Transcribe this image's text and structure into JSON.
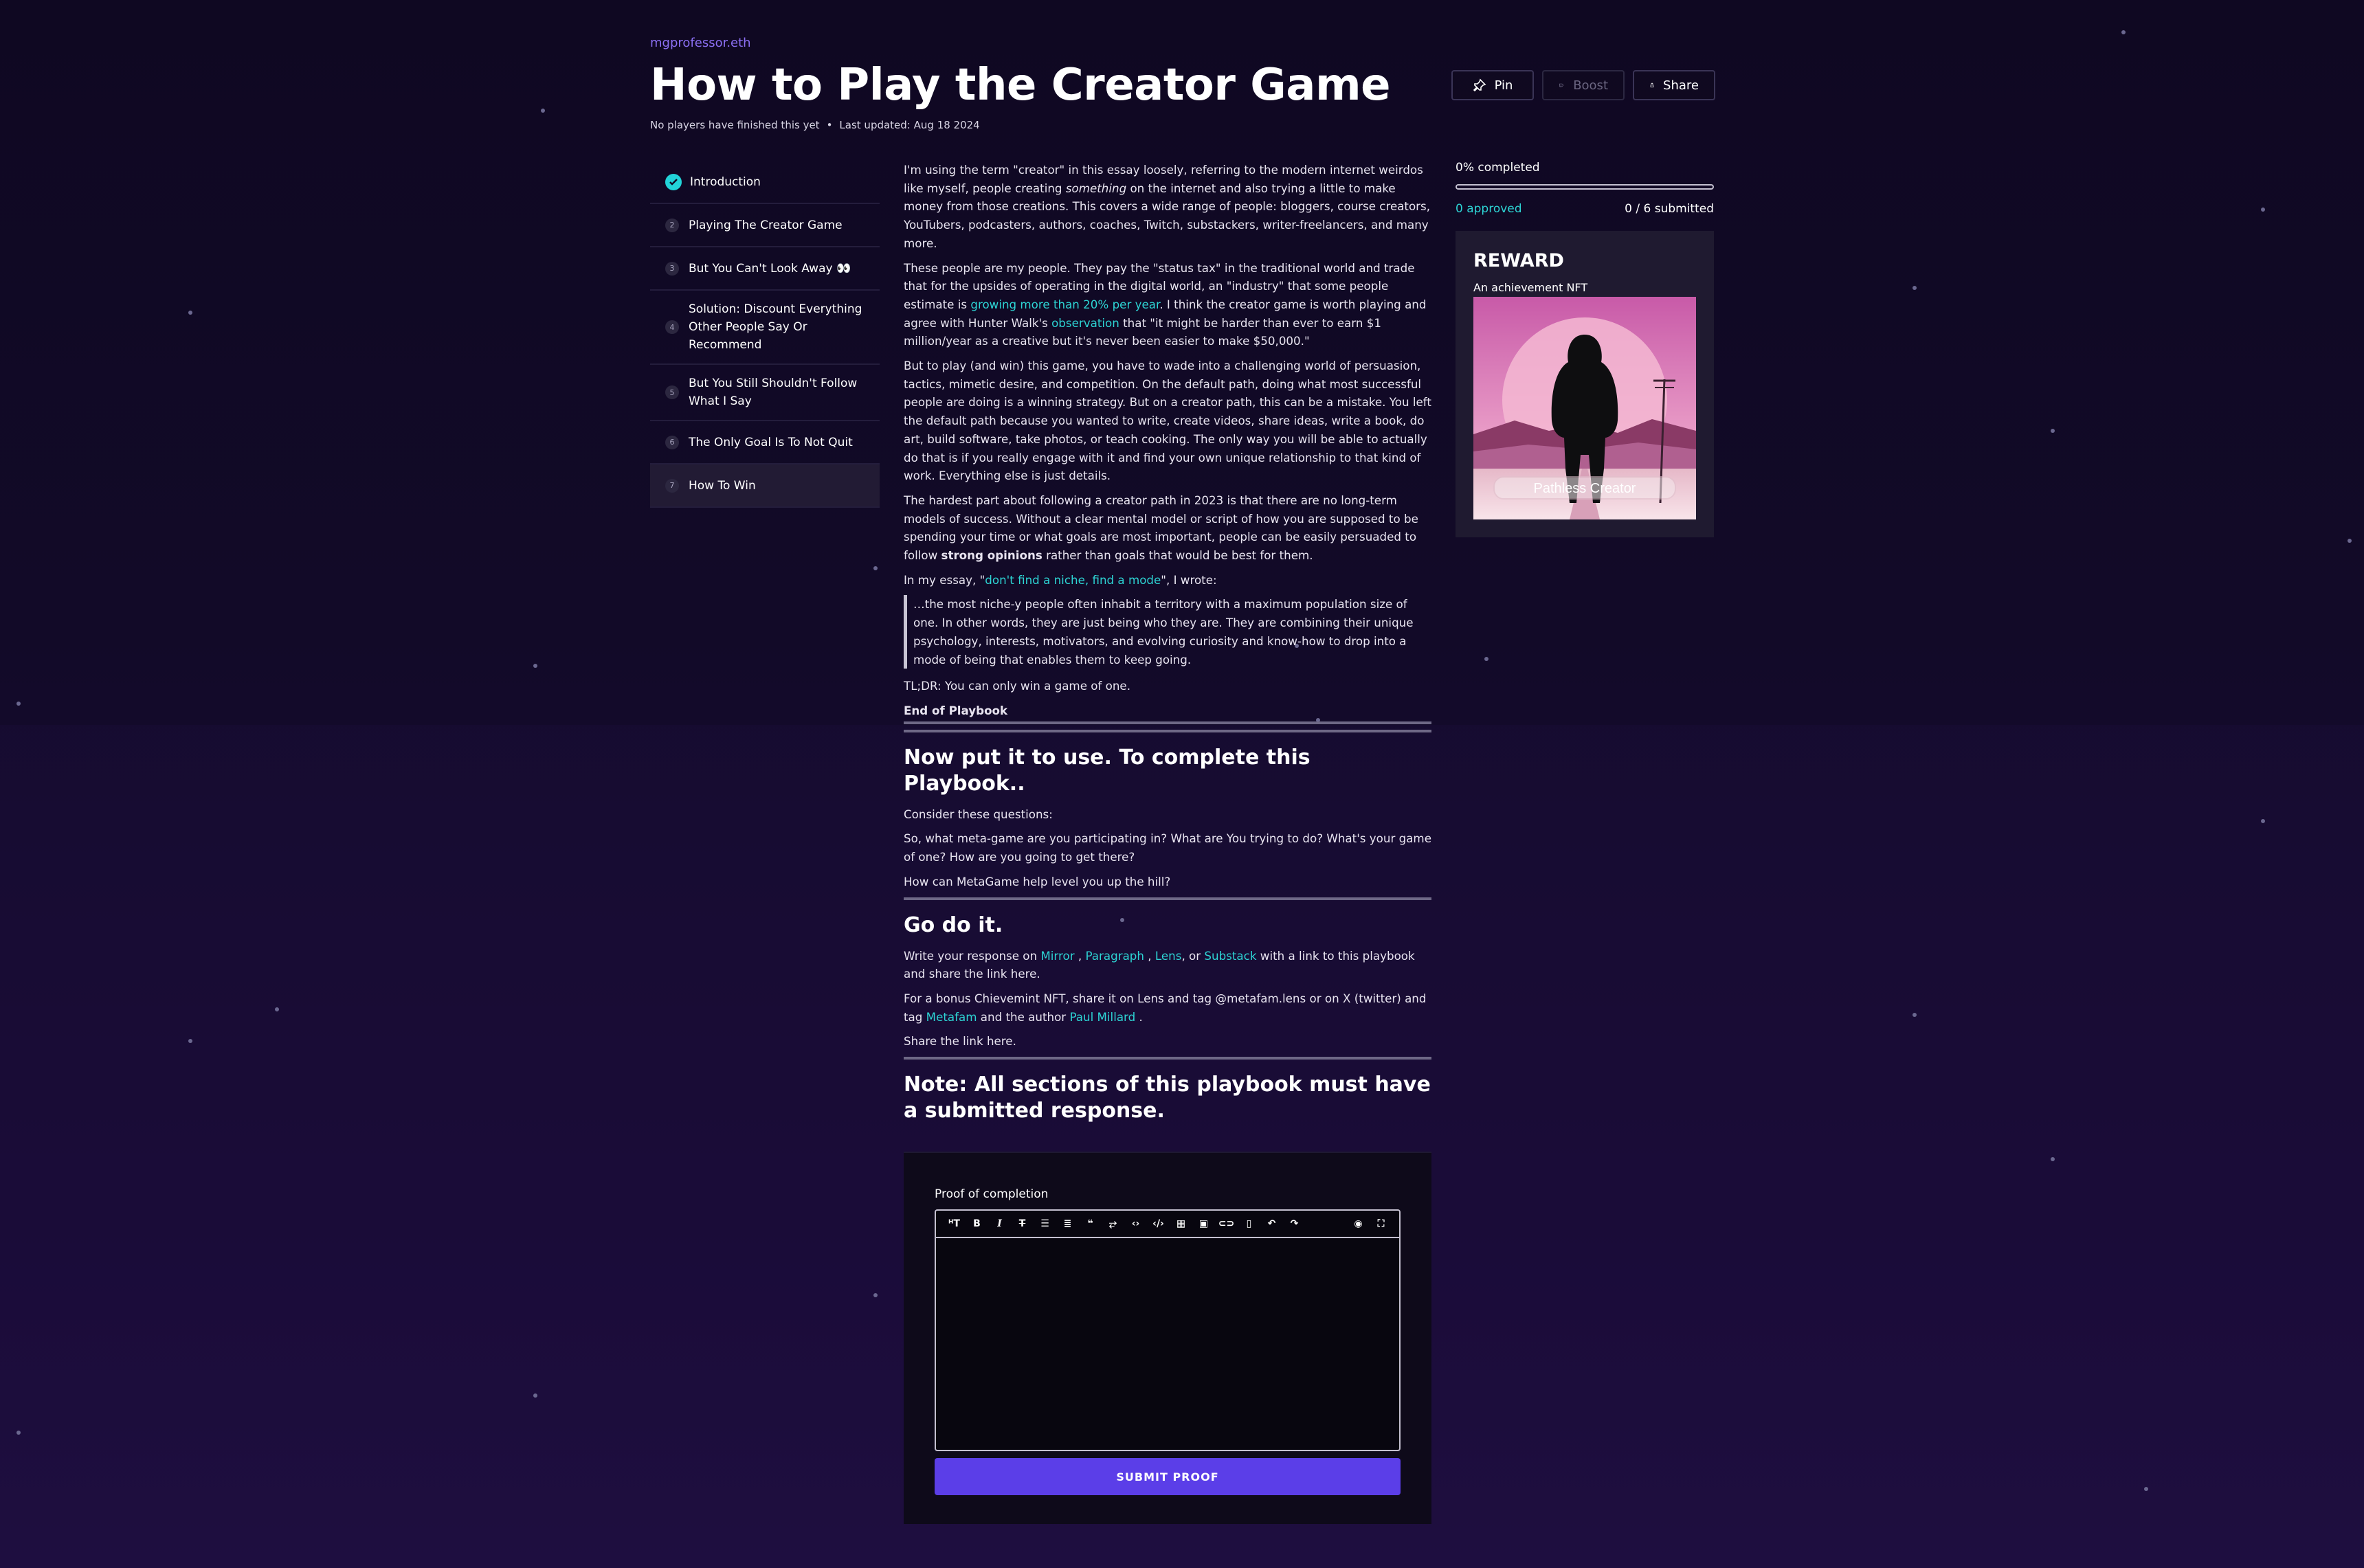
{
  "header": {
    "author": "mgprofessor.eth",
    "title": "How to Play the Creator Game",
    "players_note": "No players have finished this yet",
    "last_updated": "Last updated: Aug 18 2024"
  },
  "actions": {
    "pin": "Pin",
    "boost": "Boost",
    "share": "Share"
  },
  "toc": [
    {
      "label": "Introduction",
      "num": "1",
      "done": true
    },
    {
      "label": "Playing The Creator Game",
      "num": "2"
    },
    {
      "label": "But You Can't Look Away 👀",
      "num": "3"
    },
    {
      "label": "Solution: Discount Everything Other People Say Or Recommend",
      "num": "4"
    },
    {
      "label": "But You Still Shouldn't Follow What I Say",
      "num": "5"
    },
    {
      "label": "The Only Goal Is To Not Quit",
      "num": "6"
    },
    {
      "label": "How To Win",
      "num": "7",
      "active": true
    }
  ],
  "content": {
    "p1_a": "I'm using the term \"creator\" in this essay loosely, referring to the modern internet weirdos like myself, people creating ",
    "p1_em": "something",
    "p1_b": " on the internet and also trying a little to make money from those creations. This covers a wide range of people: bloggers, course creators, YouTubers, podcasters, authors, coaches, Twitch, substackers, writer-freelancers, and many more.",
    "p2_a": "These people are my people. They pay the \"status tax\" in the traditional world and trade that for the upsides of operating in the digital world, an \"industry\" that some people estimate is ",
    "p2_link1": "growing more than 20% per year",
    "p2_b": ". I think the creator game is worth playing and agree with Hunter Walk's ",
    "p2_link2": "observation",
    "p2_c": " that \"it might be harder than ever to earn $1 million/year as a creative but it's never been easier to make $50,000.\"",
    "p3": "But to play (and win) this game, you have to wade into a challenging world of persuasion, tactics, mimetic desire, and competition. On the default path, doing what most successful people are doing is a winning strategy. But on a creator path, this can be a mistake. You left the default path because you wanted to write, create videos, share ideas, write a book, do art, build software, take photos, or teach cooking. The only way you will be able to actually do that is if you really engage with it and find your own unique relationship to that kind of work. Everything else is just details.",
    "p4_a": "The hardest part about following a creator path in 2023 is that there are no long-term models of success. Without a clear mental model or script of how you are supposed to be spending your time or what goals are most important, people can be easily persuaded to follow ",
    "p4_strong": "strong opinions",
    "p4_b": " rather than goals that would be best for them.",
    "p5_a": "In my essay, \"",
    "p5_link": "don't find a niche, find a mode",
    "p5_b": "\", I wrote:",
    "quote": "…the most niche-y people often inhabit a territory with a maximum population size of one. In other words, they are just being who they are.  They are combining their unique psychology, interests, motivators, and evolving curiosity and know-how to drop into a mode of being that enables them to keep going.",
    "tldr": "TL;DR: You can only win a game of one.",
    "end": "End of Playbook",
    "h_put": "Now put it to use. To complete this Playbook..",
    "consider": "Consider these questions:",
    "q1": "So, what meta-game are you participating in? What are You trying to do? What's your game of one? How are you going to get there?",
    "q2": "How can MetaGame help level you up the hill?",
    "h_go": "Go do it.",
    "w_a": "Write your response on ",
    "w_mirror": "Mirror",
    "w_sep1": " , ",
    "w_paragraph": "Paragraph",
    "w_sep2": " , ",
    "w_lens": "Lens",
    "w_sep3": ", or ",
    "w_substack": "Substack",
    "w_b": " with a link to this playbook and share the link here.",
    "b_a": "For a bonus Chievemint NFT, share it on Lens and tag @metafam.lens or on X (twitter) and tag ",
    "b_metafam": "Metafam",
    "b_b": " and the author ",
    "b_paul": "Paul Millard",
    "b_c": " .",
    "share_here": "Share the link here.",
    "h_note": "Note: All sections of this playbook must have a submitted response."
  },
  "proof": {
    "label": "Proof of completion",
    "toolbar": [
      "heading-icon",
      "bold-icon",
      "italic-icon",
      "strikethrough-icon",
      "bullet-list-icon",
      "ordered-list-icon",
      "quote-icon",
      "wrap-icon",
      "code-icon",
      "code-block-icon",
      "table-icon",
      "image-icon",
      "link-icon",
      "clipboard-icon",
      "undo-icon",
      "redo-icon",
      "preview-icon",
      "fullscreen-icon"
    ],
    "submit": "SUBMIT PROOF"
  },
  "sidebar": {
    "completed": "0% completed",
    "progress": 0,
    "approved": "0 approved",
    "submitted": "0 / 6 submitted",
    "reward_title": "REWARD",
    "reward_sub": "An achievement NFT",
    "nft_label": "Pathless Creator"
  },
  "colors": {
    "accent": "#2dd4d4",
    "primary": "#5b3ee8",
    "author": "#8b6ff2"
  }
}
